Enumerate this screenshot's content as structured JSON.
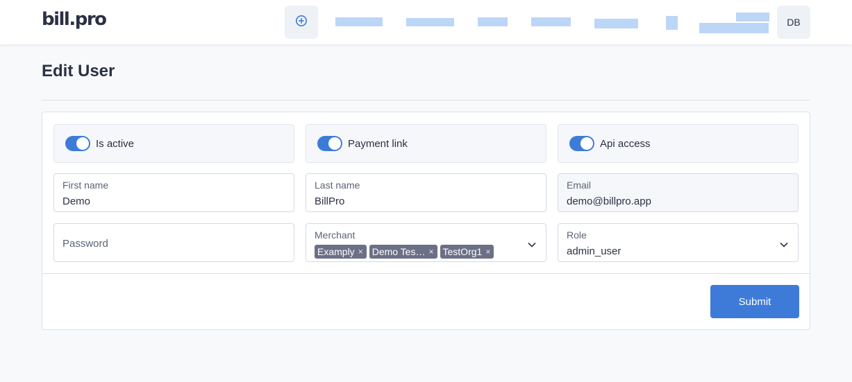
{
  "header": {
    "logo": "bill.pro",
    "add_icon": "plus-circle-icon",
    "avatar_initials": "DB",
    "colors": {
      "accent": "#3e7bd8",
      "nav_placeholder": "#bcd6f7"
    }
  },
  "page": {
    "title": "Edit User"
  },
  "form": {
    "toggles": [
      {
        "label": "Is active",
        "on": true
      },
      {
        "label": "Payment link",
        "on": true
      },
      {
        "label": "Api access",
        "on": true
      }
    ],
    "first_name": {
      "label": "First name",
      "value": "Demo"
    },
    "last_name": {
      "label": "Last name",
      "value": "BillPro"
    },
    "email": {
      "label": "Email",
      "value": "demo@billpro.app"
    },
    "password": {
      "placeholder": "Password"
    },
    "merchant": {
      "label": "Merchant",
      "chips": [
        "Examply",
        "Demo Tes…",
        "TestOrg1"
      ],
      "chip_remove": "×"
    },
    "role": {
      "label": "Role",
      "value": "admin_user"
    },
    "submit_label": "Submit"
  }
}
